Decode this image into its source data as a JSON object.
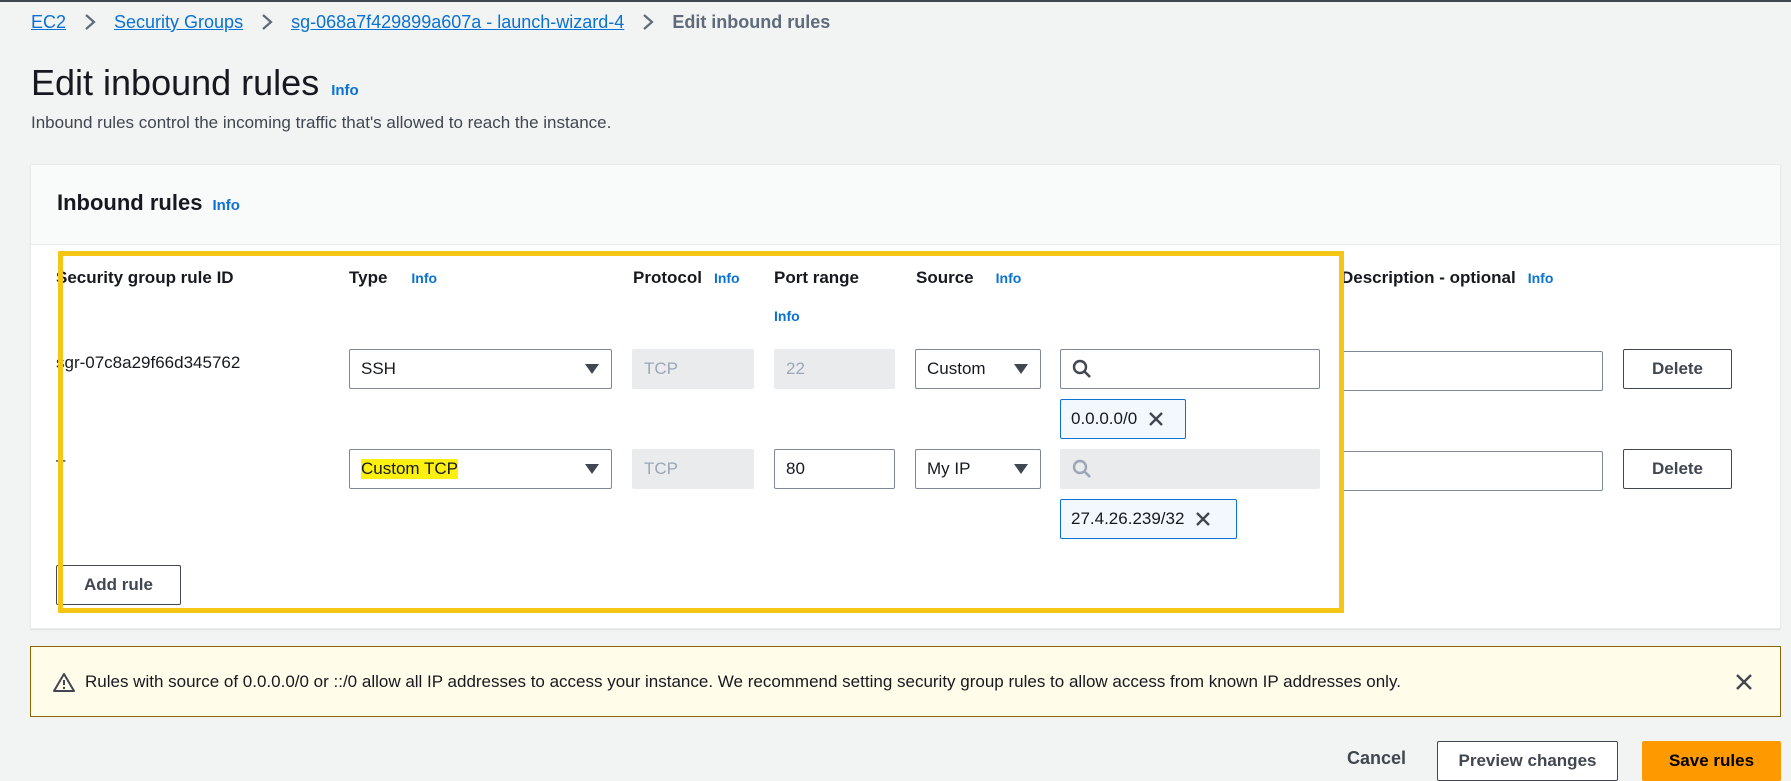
{
  "breadcrumb": {
    "items": [
      "EC2",
      "Security Groups",
      "sg-068a7f429899a607a - launch-wizard-4"
    ],
    "current": "Edit inbound rules"
  },
  "page": {
    "title": "Edit inbound rules",
    "info": "Info",
    "description": "Inbound rules control the incoming traffic that's allowed to reach the instance."
  },
  "panel": {
    "title": "Inbound rules",
    "info": "Info",
    "columns": {
      "rule_id": "Security group rule ID",
      "type": "Type",
      "protocol": "Protocol",
      "port_range": "Port range",
      "source": "Source",
      "description": "Description - optional",
      "info": "Info"
    },
    "rules": [
      {
        "rule_id": "sgr-07c8a29f66d345762",
        "type": "SSH",
        "protocol": "TCP",
        "port_range": "22",
        "source": "Custom",
        "search_value": "",
        "token": "0.0.0.0/0",
        "description": "",
        "delete_label": "Delete"
      },
      {
        "rule_id": "–",
        "type": "Custom TCP",
        "protocol": "TCP",
        "port_range": "80",
        "source": "My IP",
        "search_value": "",
        "token": "27.4.26.239/32",
        "description": "",
        "delete_label": "Delete"
      }
    ],
    "add_rule_label": "Add rule"
  },
  "warning": {
    "text": "Rules with source of 0.0.0.0/0 or ::/0 allow all IP addresses to access your instance. We recommend setting security group rules to allow access from known IP addresses only."
  },
  "footer": {
    "cancel": "Cancel",
    "preview": "Preview changes",
    "save": "Save rules"
  },
  "colors": {
    "link": "#0972d3",
    "primary_button": "#ff9900",
    "highlight_border": "#f5c518",
    "highlight_text": "#fbf00f",
    "warning_bg": "#fffce9"
  },
  "icons": [
    "chevron-right-icon",
    "search-icon",
    "close-icon",
    "warning-icon"
  ]
}
